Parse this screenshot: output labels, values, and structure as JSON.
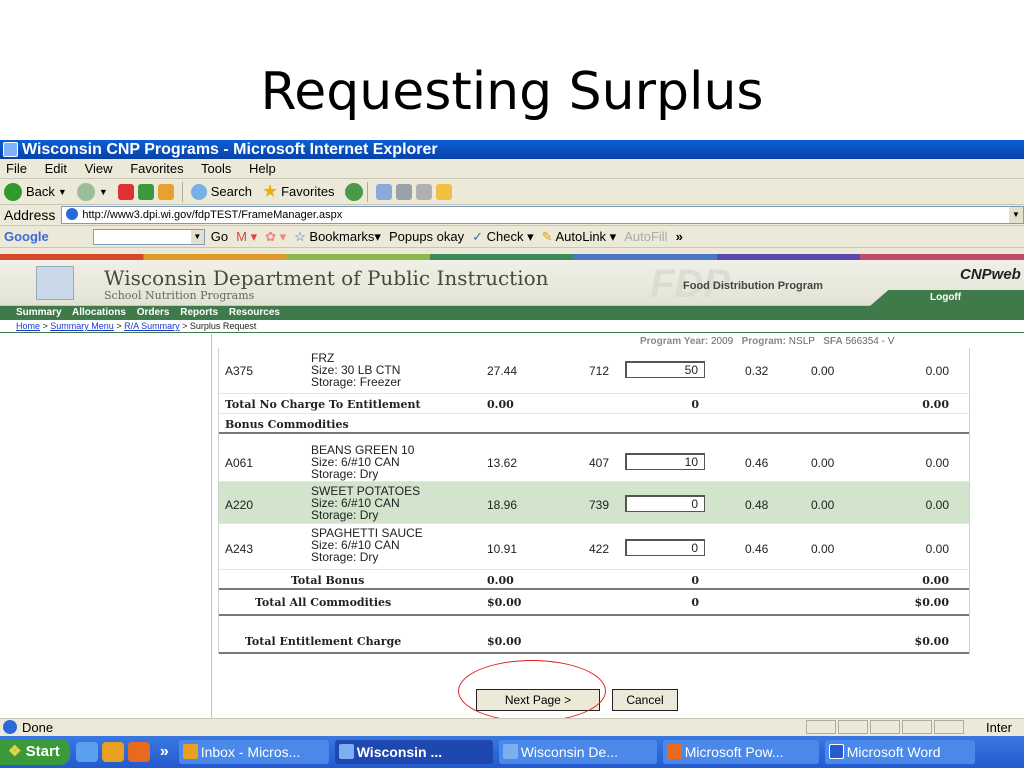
{
  "slide": {
    "title": "Requesting Surplus"
  },
  "window": {
    "title": "Wisconsin CNP Programs - Microsoft Internet Explorer"
  },
  "menu": [
    "File",
    "Edit",
    "View",
    "Favorites",
    "Tools",
    "Help"
  ],
  "toolbar": {
    "back": "Back",
    "search": "Search",
    "favorites": "Favorites"
  },
  "address": {
    "label": "Address",
    "url": "http://www3.dpi.wi.gov/fdpTEST/FrameManager.aspx"
  },
  "google": {
    "logo": "Google",
    "go": "Go",
    "bookmarks": "Bookmarks▾",
    "popups": "Popups okay",
    "check": "Check ▾",
    "autolink": "AutoLink ▾",
    "autofill": "AutoFill",
    "more": "»"
  },
  "site": {
    "title": "Wisconsin Department of Public Instruction",
    "subtitle": "School Nutrition Programs",
    "fdp_watermark": "FDP",
    "fdp_label": "Food Distribution Program",
    "cn_logo": "CNPweb",
    "logoff": "Logoff",
    "nav": [
      "Summary",
      "Allocations",
      "Orders",
      "Reports",
      "Resources"
    ],
    "breadcrumb": {
      "home": "Home",
      "menu": "Summary Menu",
      "ra": "R/A Summary",
      "current": "Surplus Request"
    },
    "program_line": {
      "year_label": "Program Year:",
      "year": "2009",
      "program_label": "Program:",
      "program": "NSLP",
      "sfa_label": "SFA",
      "sfa": "566354 - V"
    }
  },
  "rows": [
    {
      "code": "A375",
      "name": "FRZ",
      "size": "Size:  30 LB CTN",
      "storage": "Storage:  Freezer",
      "cost": "27.44",
      "qty": "712",
      "input": "50",
      "unit": "0.32",
      "v2": "0.00",
      "total": "0.00"
    },
    {
      "code": "A061",
      "name": "BEANS GREEN 10",
      "size": "Size:  6/#10 CAN",
      "storage": "Storage:  Dry",
      "cost": "13.62",
      "qty": "407",
      "input": "10",
      "unit": "0.46",
      "v2": "0.00",
      "total": "0.00"
    },
    {
      "code": "A220",
      "name": "SWEET POTATOES",
      "size": "Size:  6/#10 CAN",
      "storage": "Storage:  Dry",
      "cost": "18.96",
      "qty": "739",
      "input": "0",
      "unit": "0.48",
      "v2": "0.00",
      "total": "0.00"
    },
    {
      "code": "A243",
      "name": "SPAGHETTI SAUCE",
      "size": "Size:  6/#10 CAN",
      "storage": "Storage:  Dry",
      "cost": "10.91",
      "qty": "422",
      "input": "0",
      "unit": "0.46",
      "v2": "0.00",
      "total": "0.00"
    }
  ],
  "totals": {
    "no_charge": {
      "label": "Total No Charge To Entitlement",
      "cost": "0.00",
      "qty": "0",
      "total": "0.00"
    },
    "bonus_header": "Bonus Commodities",
    "bonus": {
      "label": "Total Bonus",
      "cost": "0.00",
      "qty": "0",
      "total": "0.00"
    },
    "all": {
      "label": "Total All Commodities",
      "cost": "$0.00",
      "qty": "0",
      "total": "$0.00"
    },
    "entitlement": {
      "label": "Total Entitlement Charge",
      "cost": "$0.00",
      "total": "$0.00"
    }
  },
  "buttons": {
    "next": "Next Page >",
    "cancel": "Cancel"
  },
  "status": {
    "text": "Done",
    "zone": "Inter"
  },
  "taskbar": {
    "start": "Start",
    "more": "»",
    "tasks": [
      "Inbox - Micros...",
      "Wisconsin ...",
      "Wisconsin De...",
      "Microsoft Pow...",
      "Microsoft Word"
    ]
  }
}
